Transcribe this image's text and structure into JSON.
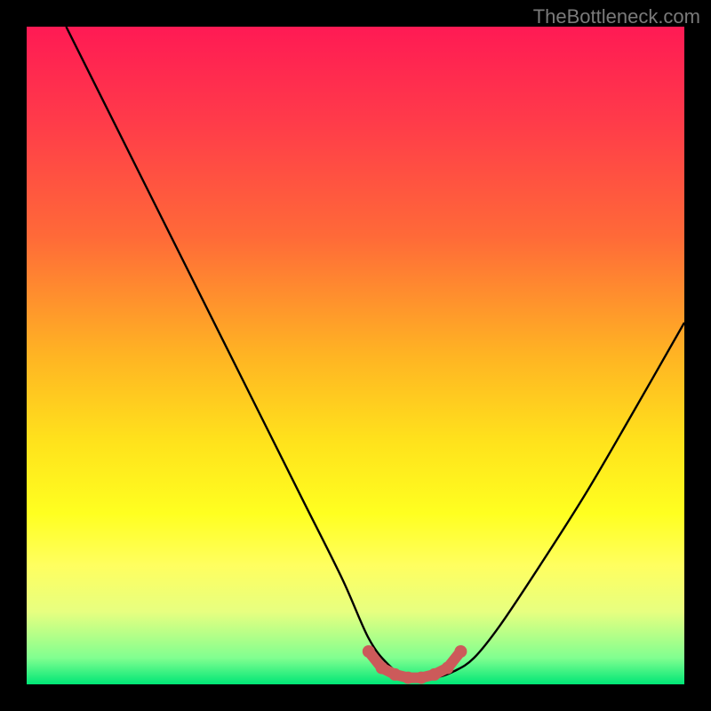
{
  "attribution": "TheBottleneck.com",
  "chart_data": {
    "type": "line",
    "title": "",
    "xlabel": "",
    "ylabel": "",
    "xlim": [
      0,
      100
    ],
    "ylim": [
      0,
      100
    ],
    "grid": false,
    "background_gradient": [
      "#ff1a54",
      "#ffe21c",
      "#00e676"
    ],
    "series": [
      {
        "name": "bottleneck-curve",
        "color": "#000000",
        "x": [
          6,
          12,
          18,
          24,
          30,
          36,
          42,
          48,
          52,
          55,
          58,
          62,
          65,
          68,
          72,
          78,
          85,
          92,
          100
        ],
        "y": [
          100,
          88,
          76,
          64,
          52,
          40,
          28,
          16,
          7,
          3,
          1,
          1,
          2,
          4,
          9,
          18,
          29,
          41,
          55
        ]
      },
      {
        "name": "optimal-range-marker",
        "color": "#cc5a5a",
        "x": [
          52,
          54,
          56,
          58,
          60,
          62,
          64,
          66
        ],
        "y": [
          5,
          2.5,
          1.5,
          1,
          1,
          1.5,
          2.5,
          5
        ]
      }
    ]
  }
}
